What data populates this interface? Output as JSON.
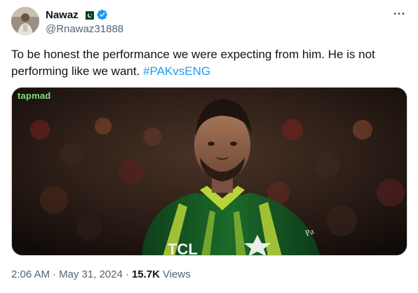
{
  "author": {
    "display_name": "Nawaz",
    "handle": "@Rnawaz31888",
    "flag_icon": "pakistan-flag-icon",
    "verified_icon": "verified-badge-icon",
    "verified_color": "#1d9bf0"
  },
  "tweet": {
    "text": "To be honest the performance we were expecting from him. He is not performing like we want. ",
    "hashtag": "#PAKvsENG",
    "hashtag_color": "#1d9bf0"
  },
  "media": {
    "watermark": "tapmad",
    "description_icon": "cricket-player-photo"
  },
  "meta": {
    "time": "2:06 AM",
    "separator1": "·",
    "date": "May 31, 2024",
    "separator2": "·",
    "views_count": "15.7K",
    "views_label": "Views"
  },
  "more_icon": "more-options-icon"
}
